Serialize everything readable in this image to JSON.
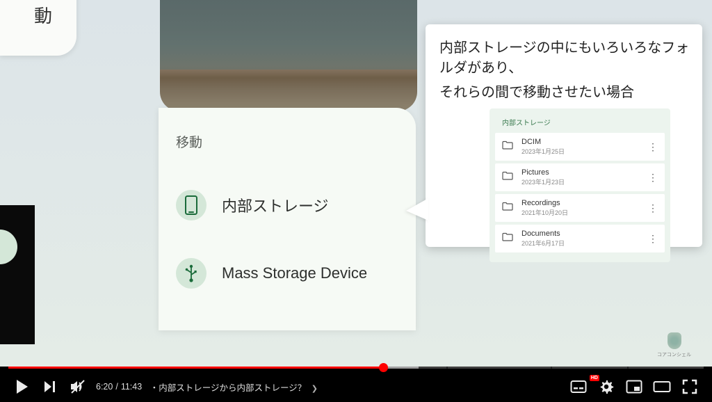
{
  "left_card_text": "動",
  "center_dialog": {
    "title": "移動",
    "options": [
      {
        "label": "内部ストレージ",
        "icon": "phone"
      },
      {
        "label": "Mass Storage Device",
        "icon": "usb"
      }
    ]
  },
  "callout": {
    "line1": "内部ストレージの中にもいろいろなフォルダがあり、",
    "line2": "それらの間で移動させたい場合",
    "folder_header": "内部ストレージ",
    "folders": [
      {
        "name": "DCIM",
        "date": "2023年1月25日"
      },
      {
        "name": "Pictures",
        "date": "2023年1月23日"
      },
      {
        "name": "Recordings",
        "date": "2021年10月20日"
      },
      {
        "name": "Documents",
        "date": "2021年6月17日"
      }
    ]
  },
  "watermark": "コアコンシェル",
  "player": {
    "current_time": "6:20",
    "duration": "11:43",
    "separator": " / ",
    "chapter_bullet": "・",
    "chapter_title": "内部ストレージから内部ストレージ？",
    "hd_label": "HD"
  }
}
